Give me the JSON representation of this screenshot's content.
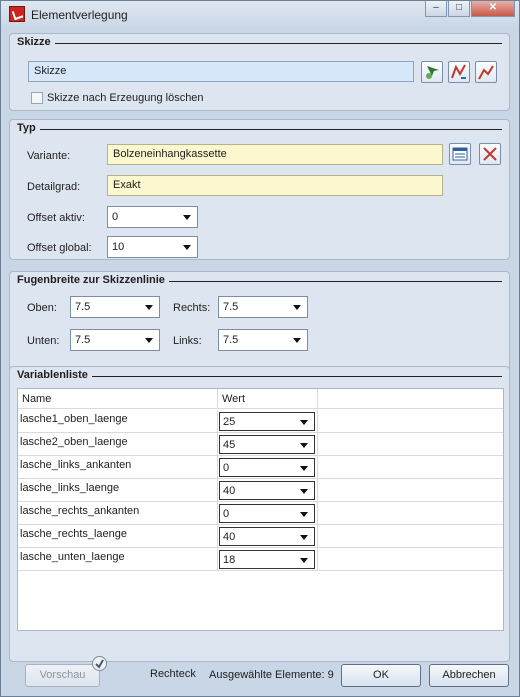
{
  "window": {
    "title": "Elementverlegung",
    "close_glyph": "✕",
    "min_glyph": "–",
    "max_glyph": "□"
  },
  "skizze": {
    "heading": "Skizze",
    "value": "Skizze",
    "checkbox_label": "Skizze nach Erzeugung löschen",
    "checkbox_checked": false,
    "icons": [
      "pick-sketch-icon",
      "sketch-edit-icon",
      "sketch-line-icon"
    ]
  },
  "typ": {
    "heading": "Typ",
    "variante_label": "Variante:",
    "variante_value": "Bolzeneinhangkassette",
    "detailgrad_label": "Detailgrad:",
    "detailgrad_value": "Exakt",
    "offset_aktiv_label": "Offset aktiv:",
    "offset_aktiv_value": "0",
    "offset_global_label": "Offset global:",
    "offset_global_value": "10"
  },
  "fugen": {
    "heading": "Fugenbreite zur Skizzenlinie",
    "oben_label": "Oben:",
    "oben_value": "7.5",
    "rechts_label": "Rechts:",
    "rechts_value": "7.5",
    "unten_label": "Unten:",
    "unten_value": "7.5",
    "links_label": "Links:",
    "links_value": "7.5"
  },
  "variablen": {
    "heading": "Variablenliste",
    "columns": [
      "Name",
      "Wert"
    ],
    "rows": [
      {
        "name": "lasche1_oben_laenge",
        "wert": "25"
      },
      {
        "name": "lasche2_oben_laenge",
        "wert": "45"
      },
      {
        "name": "lasche_links_ankanten",
        "wert": "0"
      },
      {
        "name": "lasche_links_laenge",
        "wert": "40"
      },
      {
        "name": "lasche_rechts_ankanten",
        "wert": "0"
      },
      {
        "name": "lasche_rechts_laenge",
        "wert": "40"
      },
      {
        "name": "lasche_unten_laenge",
        "wert": "18"
      }
    ]
  },
  "footer": {
    "vorschau": "Vorschau",
    "rechteck": "Rechteck",
    "ausgewaehlt": "Ausgewählte Elemente: 9",
    "ok": "OK",
    "abbrechen": "Abbrechen"
  }
}
